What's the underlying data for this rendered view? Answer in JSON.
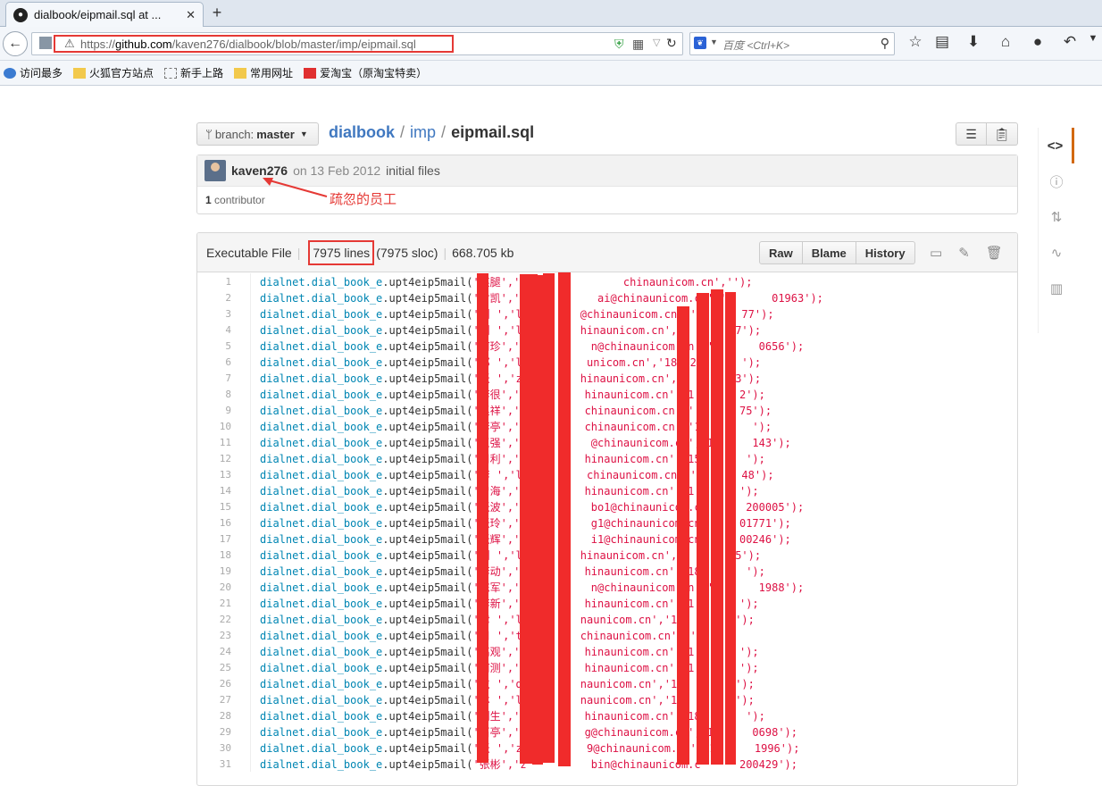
{
  "browser": {
    "tab_title": "dialbook/eipmail.sql at ...",
    "new_tab": "+",
    "url_prefix": "https://",
    "url_host": "github.com",
    "url_path": "/kaven276/dialbook/blob/master/imp/eipmail.sql",
    "search_placeholder": "百度 <Ctrl+K>"
  },
  "bookmarks": [
    {
      "label": "访问最多",
      "icon": "firefox-icon"
    },
    {
      "label": "火狐官方站点",
      "icon": "folder-icon"
    },
    {
      "label": "新手上路",
      "icon": "page-icon"
    },
    {
      "label": "常用网址",
      "icon": "folder-icon"
    },
    {
      "label": "爱淘宝（原淘宝特卖）",
      "icon": "taobao-icon"
    }
  ],
  "repo": {
    "branch_label": "branch:",
    "branch_value": "master",
    "repo_name": "dialbook",
    "dir_name": "imp",
    "file_name": "eipmail.sql",
    "sep": "/"
  },
  "commit": {
    "author": "kaven276",
    "date": "on 13 Feb 2012",
    "message": "initial files",
    "contributors_count": "1",
    "contributors_label": "contributor"
  },
  "annotation": "疏忽的员工",
  "file_header": {
    "type": "Executable File",
    "lines": "7975 lines",
    "sloc": "(7975 sloc)",
    "size": "668.705 kb",
    "raw_btn": "Raw",
    "blame_btn": "Blame",
    "history_btn": "History"
  },
  "code_lines": [
    {
      "n": "1",
      "obj": "dialnet.dial_book_e",
      "fn": ".upt4eip5mail(",
      "str": "'某腿','s               chinaunicom.cn','');"
    },
    {
      "n": "2",
      "obj": "dialnet.dial_book_e",
      "fn": ".upt4eip5mail(",
      "str": "'付凯','m           ai@chinaunicom.cn','       01963');"
    },
    {
      "n": "3",
      "obj": "dialnet.dial_book_e",
      "fn": ".upt4eip5mail(",
      "str": "'刘 ','li        @chinaunicom.cn','       77');"
    },
    {
      "n": "4",
      "obj": "dialnet.dial_book_e",
      "fn": ".upt4eip5mail(",
      "str": "'刘 ','li        hinaunicom.cn','1       7');"
    },
    {
      "n": "5",
      "obj": "dialnet.dial_book_e",
      "fn": ".upt4eip5mail(",
      "str": "'何珍','m          n@chinaunicom.cn','1      0656');"
    },
    {
      "n": "6",
      "obj": "dialnet.dial_book_e",
      "fn": ".upt4eip5mail(",
      "str": "'郭 ','li         unicom.cn','18602       ');"
    },
    {
      "n": "7",
      "obj": "dialnet.dial_book_e",
      "fn": ".upt4eip5mail(",
      "str": "'张 ','zh        hinaunicom.cn','1       3');"
    },
    {
      "n": "8",
      "obj": "dialnet.dial_book_e",
      "fn": ".upt4eip5mail(",
      "str": "'李很','l         hinaunicom.cn','1       2');"
    },
    {
      "n": "9",
      "obj": "dialnet.dial_book_e",
      "fn": ".upt4eip5mail(",
      "str": "'赵祥','z         chinaunicom.cn','       75');"
    },
    {
      "n": "10",
      "obj": "dialnet.dial_book_e",
      "fn": ".upt4eip5mail(",
      "str": "'李亭','l         chinaunicom.cn','15       ');"
    },
    {
      "n": "11",
      "obj": "dialnet.dial_book_e",
      "fn": ".upt4eip5mail(",
      "str": "'王强','w          @chinaunicom.cn','1      143');"
    },
    {
      "n": "12",
      "obj": "dialnet.dial_book_e",
      "fn": ".upt4eip5mail(",
      "str": "'周利','c         hinaunicom.cn','15       ');"
    },
    {
      "n": "13",
      "obj": "dialnet.dial_book_e",
      "fn": ".upt4eip5mail(",
      "str": "'李 ','li         chinaunicom.cn','1      48');"
    },
    {
      "n": "14",
      "obj": "dialnet.dial_book_e",
      "fn": ".upt4eip5mail(",
      "str": "'曾海','c         hinaunicom.cn','1       ');"
    },
    {
      "n": "15",
      "obj": "dialnet.dial_book_e",
      "fn": ".upt4eip5mail(",
      "str": "'张波','z          bo1@chinaunicom.c       200005');"
    },
    {
      "n": "16",
      "obj": "dialnet.dial_book_e",
      "fn": ".upt4eip5mail(",
      "str": "'张玲','z          g1@chinaunicom.cn      01771');"
    },
    {
      "n": "17",
      "obj": "dialnet.dial_book_e",
      "fn": ".upt4eip5mail(",
      "str": "'张辉','z          i1@chinaunicom.cn      00246');"
    },
    {
      "n": "18",
      "obj": "dialnet.dial_book_e",
      "fn": ".upt4eip5mail(",
      "str": "'刘 ','li        hinaunicom.cn','1       5');"
    },
    {
      "n": "19",
      "obj": "dialnet.dial_book_e",
      "fn": ".upt4eip5mail(",
      "str": "'李动','l         hinaunicom.cn','18       ');"
    },
    {
      "n": "20",
      "obj": "dialnet.dial_book_e",
      "fn": ".upt4eip5mail(",
      "str": "'陈军','c          n@chinaunicom.cn','1      1988');"
    },
    {
      "n": "21",
      "obj": "dialnet.dial_book_e",
      "fn": ".upt4eip5mail(",
      "str": "'李新','l         hinaunicom.cn','1       ');"
    },
    {
      "n": "22",
      "obj": "dialnet.dial_book_e",
      "fn": ".upt4eip5mail(",
      "str": "'律 ','lv        naunicom.cn','186       ');"
    },
    {
      "n": "23",
      "obj": "dialnet.dial_book_e",
      "fn": ".upt4eip5mail(",
      "str": "'周 ','tj        chinaunicom.cn','');"
    },
    {
      "n": "24",
      "obj": "dialnet.dial_book_e",
      "fn": ".upt4eip5mail(",
      "str": "'高观','g         hinaunicom.cn','1       ');"
    },
    {
      "n": "25",
      "obj": "dialnet.dial_book_e",
      "fn": ".upt4eip5mail(",
      "str": "'何测','m         hinaunicom.cn','1       ');"
    },
    {
      "n": "26",
      "obj": "dialnet.dial_book_e",
      "fn": ".upt4eip5mail(",
      "str": "'戴 ','da        naunicom.cn','186       ');"
    },
    {
      "n": "27",
      "obj": "dialnet.dial_book_e",
      "fn": ".upt4eip5mail(",
      "str": "'林 ','li        naunicom.cn','186       ');"
    },
    {
      "n": "28",
      "obj": "dialnet.dial_book_e",
      "fn": ".upt4eip5mail(",
      "str": "'刘生','t         hinaunicom.cn','18       ');"
    },
    {
      "n": "29",
      "obj": "dialnet.dial_book_e",
      "fn": ".upt4eip5mail(",
      "str": "'石亭','s         g@chinaunicom.cn','1      0698');"
    },
    {
      "n": "30",
      "obj": "dialnet.dial_book_e",
      "fn": ".upt4eip5mail(",
      "str": "'张 ','zh         9@chinaunicom.cn','1      1996');"
    },
    {
      "n": "31",
      "obj": "dialnet.dial_book_e",
      "fn": ".upt4eip5mail(",
      "str": "'张彬','z          bin@chinaunicom.c      200429');"
    }
  ],
  "colors": {
    "highlight_red": "#e53935",
    "redaction": "#f02b2b",
    "link_blue": "#4078c0",
    "code_obj": "#0086b3",
    "code_str": "#d14"
  }
}
